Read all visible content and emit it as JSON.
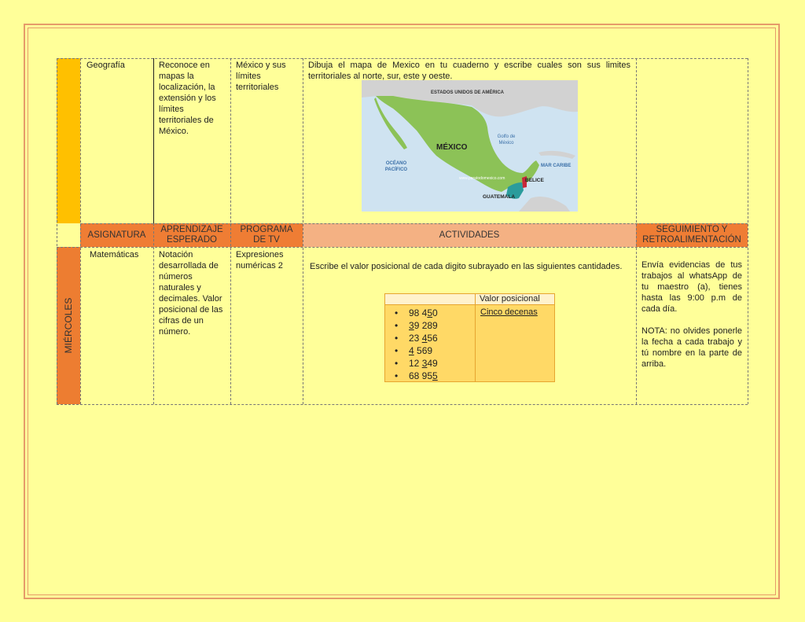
{
  "top_row": {
    "asignatura": "Geografía",
    "aprendizaje": "Reconoce en mapas la localización, la extensión y los límites territoriales de México.",
    "programa": "México y sus límites territoriales",
    "actividad": "Dibuja el mapa de Mexico en tu cuaderno y escribe cuales son sus limites territoriales al norte, sur, este y oeste.",
    "map": {
      "label_usa": "ESTADOS UNIDOS DE AMÉRICA",
      "label_mexico": "MÉXICO",
      "label_golfo": "Golfo de México",
      "label_pacifico": "OCÉANO PACÍFICO",
      "label_caribe": "MAR CARIBE",
      "label_belice": "BELICE",
      "label_guatemala": "GUATEMALA",
      "watermark": "www.paratodomexico.com",
      "colors": {
        "sea": "#cfe3f1",
        "land": "#d2d2d2",
        "mexico": "#8cc257",
        "guatemala": "#2a9c9c",
        "belize": "#c8283a"
      }
    }
  },
  "headers": {
    "asignatura": "ASIGNATURA",
    "aprendizaje": "APRENDIZAJE ESPERADO",
    "programa": "PROGRAMA DE TV",
    "actividades": "ACTIVIDADES",
    "seguimiento": "SEGUIMIENTO Y RETROALIMENTACIÓN"
  },
  "day_label": "MIÉRCOLES",
  "bottom_row": {
    "asignatura": "Matemáticas",
    "aprendizaje": "Notación desarrollada de números naturales y decimales. Valor posicional de las cifras de un número.",
    "programa": "Expresiones numéricas 2",
    "actividad": "Escribe el valor posicional de cada digito subrayado en las siguientes cantidades.",
    "seguimiento": "Envía evidencias de tus trabajos al whatsApp de tu maestro (a), tienes hasta las 9:00 p.m de cada día.",
    "nota": "NOTA: no olvides ponerle la fecha a cada trabajo y tú nombre en la parte de arriba.",
    "table": {
      "header": "Valor posicional",
      "numbers": [
        {
          "pre": "98 4",
          "u": "5",
          "post": "0"
        },
        {
          "pre": "",
          "u": "3",
          "post": "9 289"
        },
        {
          "pre": "23 ",
          "u": "4",
          "post": "56"
        },
        {
          "pre": "",
          "u": "4",
          "post": " 569"
        },
        {
          "pre": "12 ",
          "u": "3",
          "post": "49"
        },
        {
          "pre": "68 95",
          "u": "5",
          "post": ""
        }
      ],
      "answer": "Cinco decenas"
    }
  },
  "colors": {
    "page_bg": "#ffff99",
    "header_orange": "#ef7d34",
    "header_salmon": "#f4b183",
    "day_bar_top": "#ffc000",
    "day_bar_bottom": "#ed7d31",
    "table_bg": "#ffd966"
  }
}
